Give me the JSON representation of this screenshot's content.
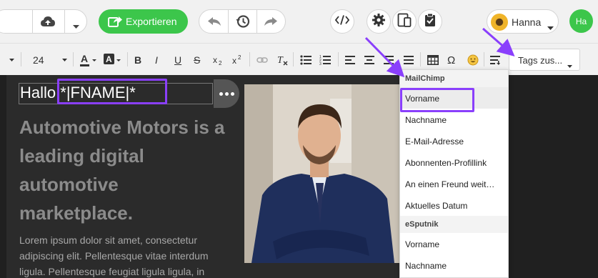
{
  "topbar": {
    "export_label": "Exportieren",
    "user_name": "Hanna",
    "avatar_initials": "Ha"
  },
  "format_toolbar": {
    "font_size": "24",
    "tags_select_value": "Tags zus..."
  },
  "editor": {
    "greeting_prefix": "Hallo",
    "greeting_merge_tag": "*|FNAME|*",
    "headline": "Automotive Motors is a leading digital automotive marketplace.",
    "body": "Lorem ipsum dolor sit amet, consectetur adipiscing elit. Pellentesque vitae interdum ligula. Pellentesque feugiat ligula ligula, in"
  },
  "tags_dropdown": {
    "groups": [
      {
        "label": "MailChimp",
        "items": [
          "Vorname",
          "Nachname",
          "E-Mail-Adresse",
          "Abonnenten-Profillink",
          "An einen Freund weit…",
          "Aktuelles Datum"
        ]
      },
      {
        "label": "eSputnik",
        "items": [
          "Vorname",
          "Nachname"
        ]
      }
    ]
  },
  "colors": {
    "accent_green": "#3cc64b",
    "highlight_purple": "#8a3ffc",
    "canvas_dark": "#2b2b2b"
  }
}
